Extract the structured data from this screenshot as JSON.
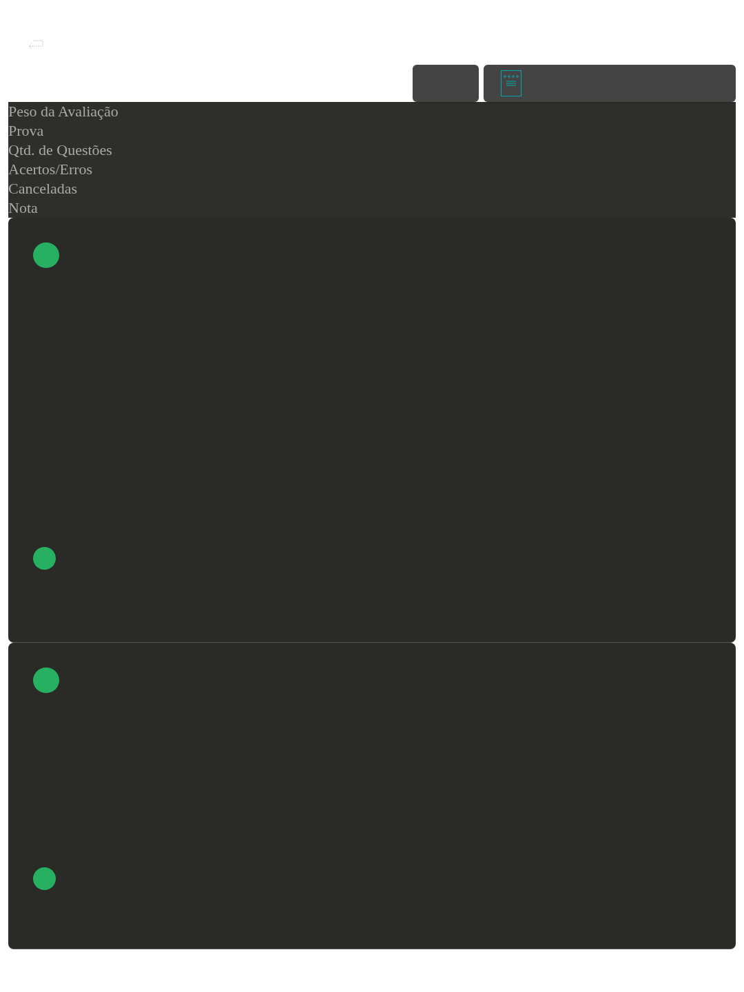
{
  "columns": [
    "Peso da Avaliação",
    "Prova",
    "Qtd. de Questões",
    "Acertos/Erros",
    "Canceladas",
    "Nota"
  ],
  "cards": [
    {
      "kind": "tall"
    },
    {
      "kind": "short"
    }
  ]
}
